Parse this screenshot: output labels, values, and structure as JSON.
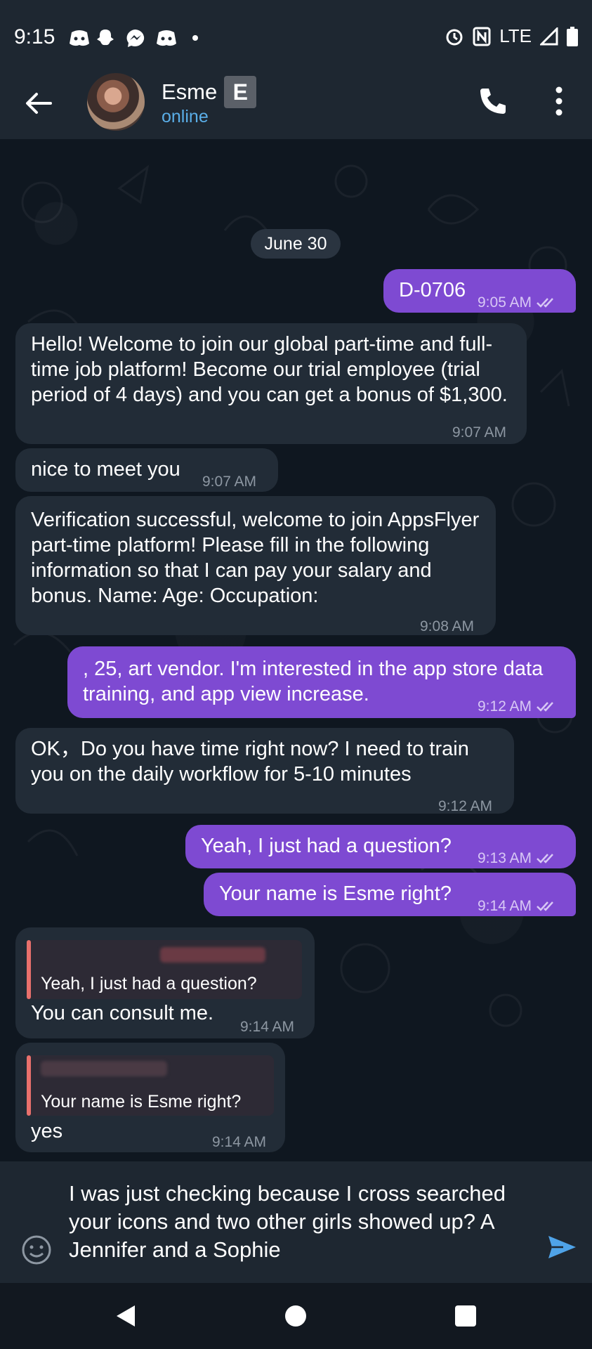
{
  "status_bar": {
    "time": "9:15",
    "network": "LTE",
    "icons": [
      "discord-icon",
      "snapchat-icon",
      "messenger-icon",
      "discord-icon",
      "dot-icon",
      "alarm-icon",
      "nfc-icon",
      "signal-icon",
      "battery-icon"
    ]
  },
  "header": {
    "name": "Esme",
    "badge": "E",
    "status": "online"
  },
  "chat": {
    "date": "June 30",
    "messages": [
      {
        "dir": "out",
        "text": "D-0706",
        "time": "9:05 AM"
      },
      {
        "dir": "in",
        "text": "Hello! Welcome to join our global part-time and full-time job platform! Become our trial employee (trial period of 4 days) and you can get a bonus of $1,300.",
        "time": "9:07 AM"
      },
      {
        "dir": "in",
        "text": "nice to meet you",
        "time": "9:07 AM"
      },
      {
        "dir": "in",
        "text": "Verification successful, welcome to join AppsFlyer part-time platform! Please fill in the following information so that I can pay your salary and bonus. Name: Age: Occupation:",
        "time": "9:08 AM"
      },
      {
        "dir": "out",
        "text": ", 25, art vendor. I'm interested in the app store data training, and app view increase.",
        "time": "9:12 AM"
      },
      {
        "dir": "in",
        "text": "OK，Do you have time right now? I need to train you on the daily workflow for 5-10 minutes",
        "time": "9:12 AM"
      },
      {
        "dir": "out",
        "text": "Yeah, I just had a question?",
        "time": "9:13 AM"
      },
      {
        "dir": "out",
        "text": "Your name is Esme right?",
        "time": "9:14 AM"
      },
      {
        "dir": "in",
        "reply": "Yeah, I just had a question?",
        "text": "You can consult me.",
        "time": "9:14 AM"
      },
      {
        "dir": "in",
        "reply": "Your name is Esme right?",
        "text": "yes",
        "time": "9:14 AM"
      }
    ]
  },
  "composer": {
    "text": "I was just checking because I cross searched your icons and two other girls showed up? A Jennifer and a Sophie"
  },
  "colors": {
    "outgoing_bubble": "#7e4ad2",
    "incoming_bubble": "#222c37",
    "accent": "#5aaee8"
  }
}
